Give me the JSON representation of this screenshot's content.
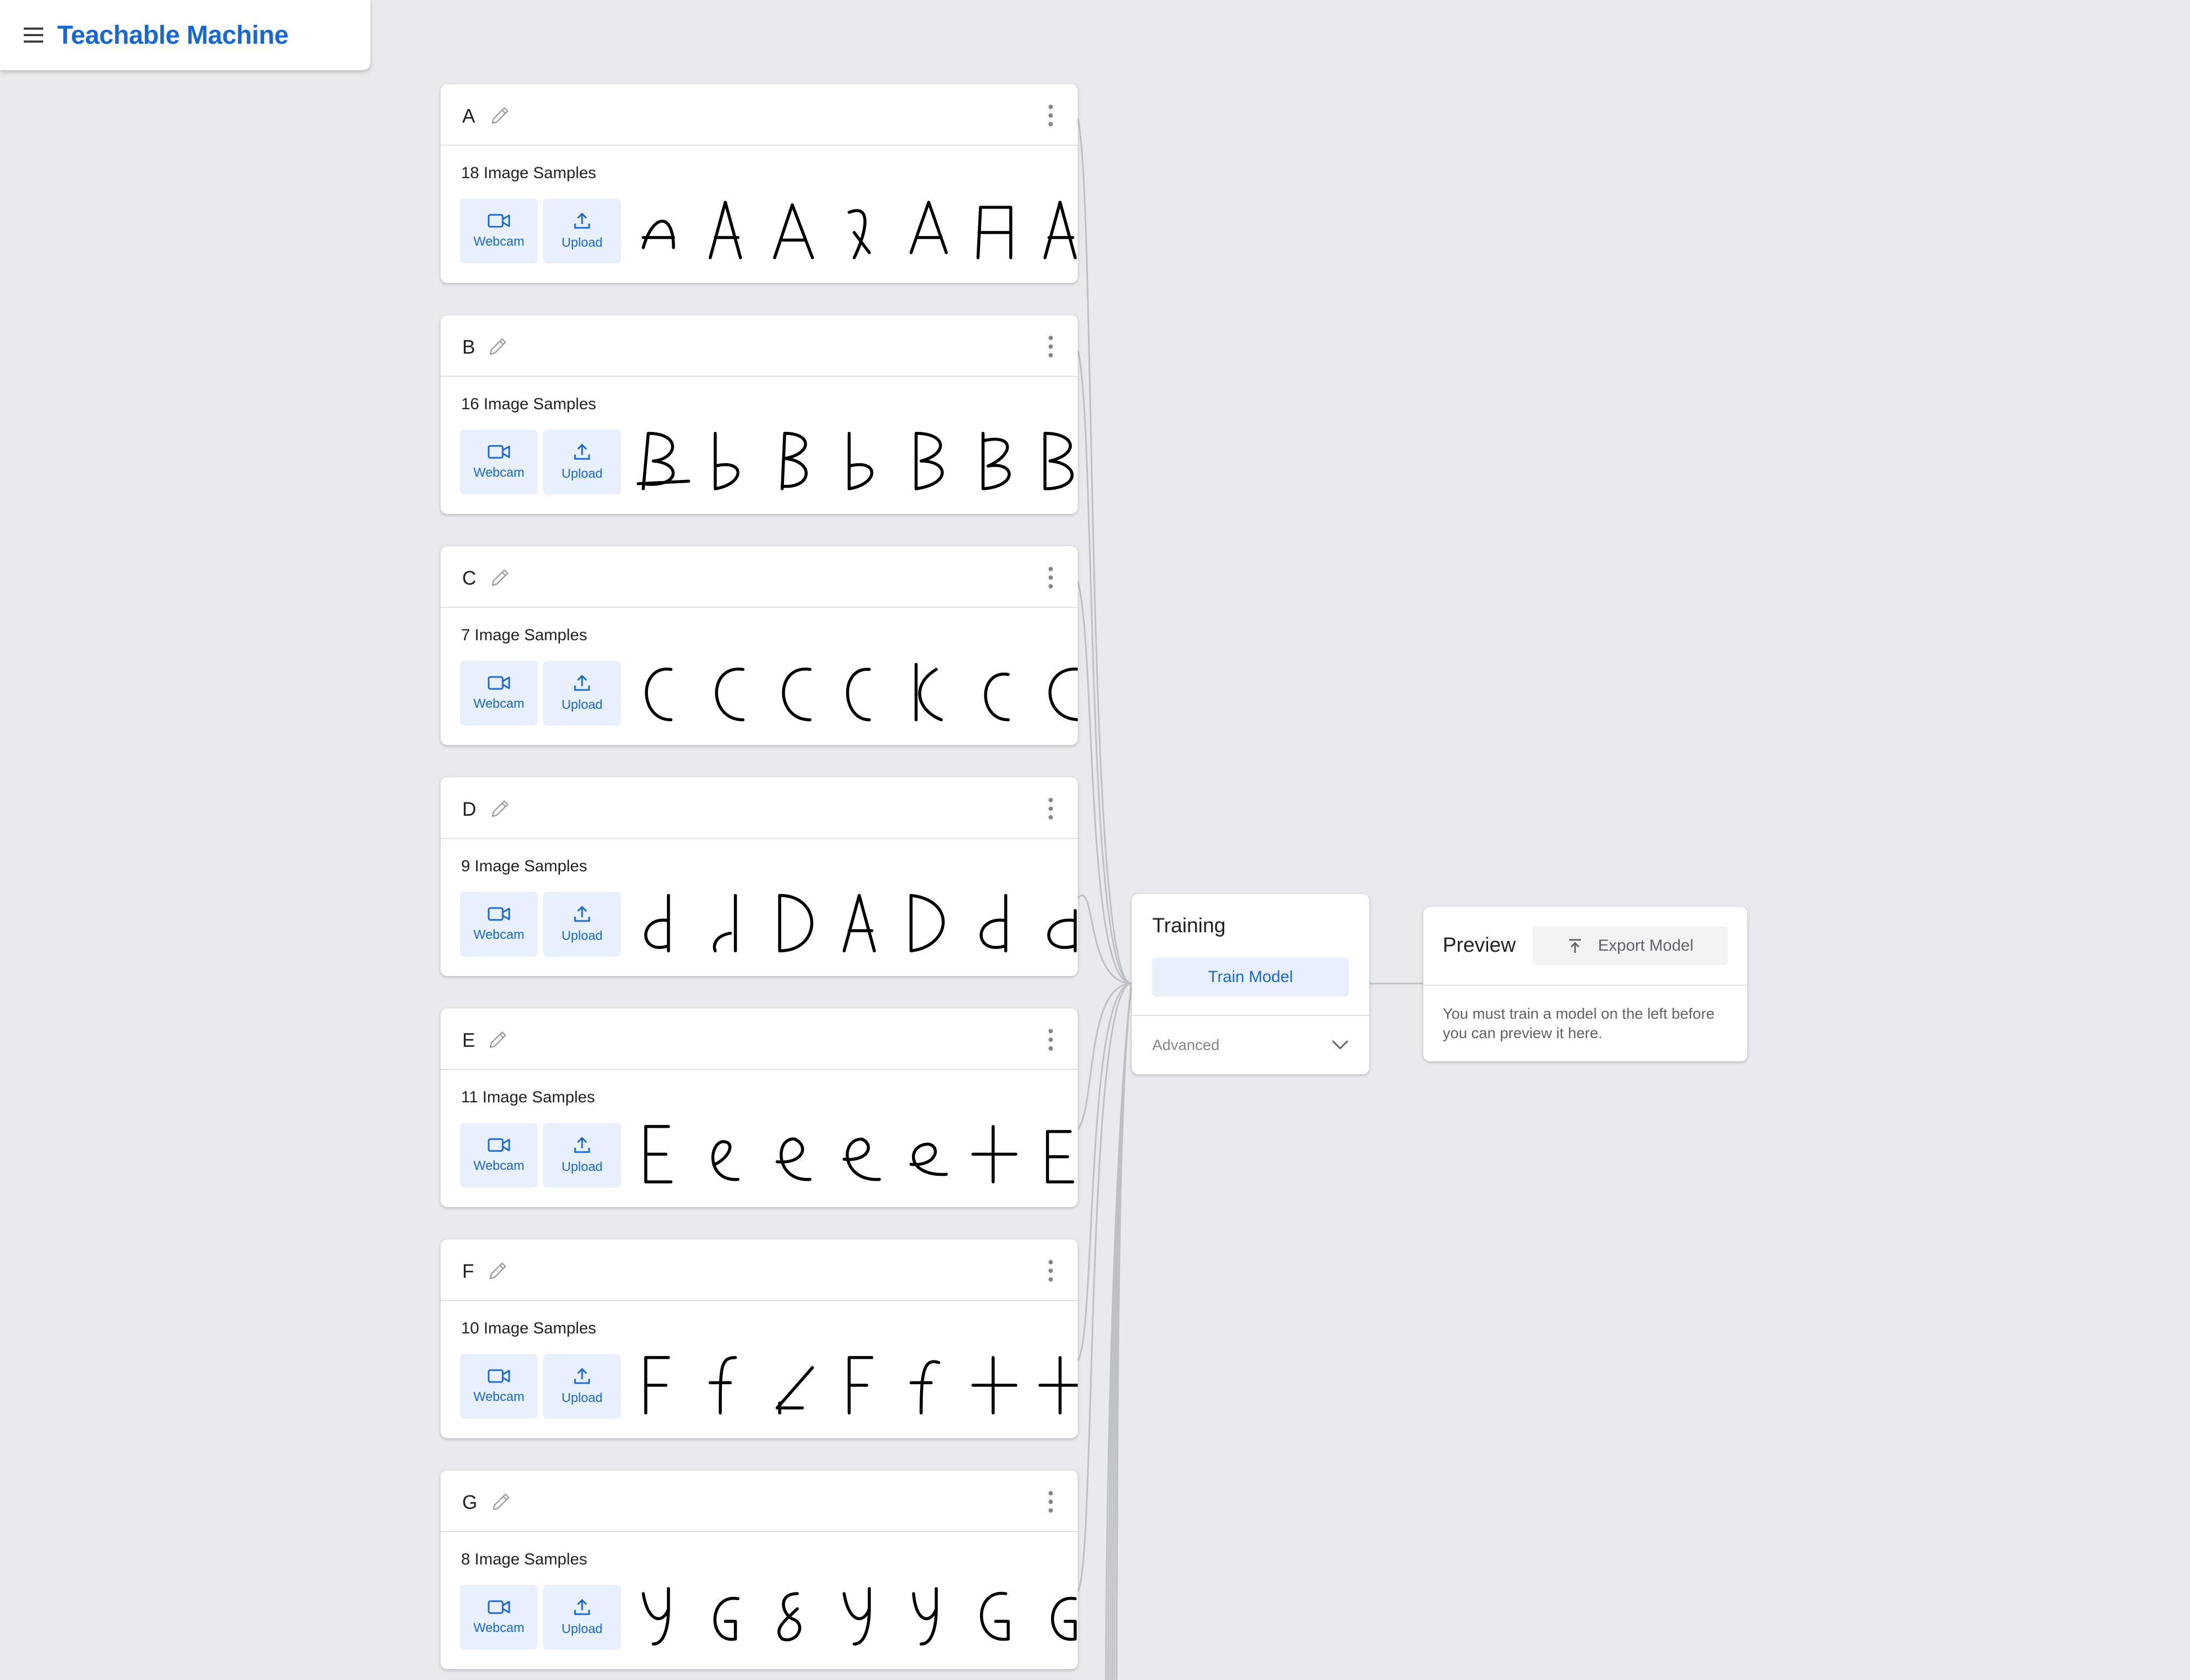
{
  "app": {
    "title": "Teachable Machine"
  },
  "classes": [
    {
      "name": "A",
      "sample_count": "18 Image Samples",
      "webcam_label": "Webcam",
      "upload_label": "Upload"
    },
    {
      "name": "B",
      "sample_count": "16 Image Samples",
      "webcam_label": "Webcam",
      "upload_label": "Upload"
    },
    {
      "name": "C",
      "sample_count": "7 Image Samples",
      "webcam_label": "Webcam",
      "upload_label": "Upload"
    },
    {
      "name": "D",
      "sample_count": "9 Image Samples",
      "webcam_label": "Webcam",
      "upload_label": "Upload"
    },
    {
      "name": "E",
      "sample_count": "11 Image Samples",
      "webcam_label": "Webcam",
      "upload_label": "Upload"
    },
    {
      "name": "F",
      "sample_count": "10 Image Samples",
      "webcam_label": "Webcam",
      "upload_label": "Upload"
    },
    {
      "name": "G",
      "sample_count": "8 Image Samples",
      "webcam_label": "Webcam",
      "upload_label": "Upload"
    }
  ],
  "training": {
    "title": "Training",
    "train_button": "Train Model",
    "advanced_label": "Advanced"
  },
  "preview": {
    "title": "Preview",
    "export_button": "Export Model",
    "message": "You must train a model on the left before you can preview it here."
  },
  "colors": {
    "brand": "#1967d2",
    "button_bg": "#e8f0fe",
    "scrollbar": "#aecbfa",
    "background": "#e8eaed"
  }
}
